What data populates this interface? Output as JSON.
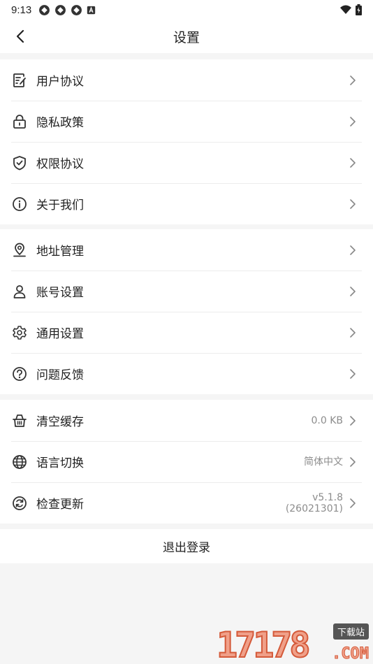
{
  "status_bar": {
    "time": "9:13"
  },
  "header": {
    "title": "设置"
  },
  "groups": [
    {
      "items": [
        {
          "label": "用户协议",
          "icon": "document-edit-icon"
        },
        {
          "label": "隐私政策",
          "icon": "lock-icon"
        },
        {
          "label": "权限协议",
          "icon": "shield-check-icon"
        },
        {
          "label": "关于我们",
          "icon": "info-icon"
        }
      ]
    },
    {
      "items": [
        {
          "label": "地址管理",
          "icon": "location-pin-icon"
        },
        {
          "label": "账号设置",
          "icon": "user-icon"
        },
        {
          "label": "通用设置",
          "icon": "gear-icon"
        },
        {
          "label": "问题反馈",
          "icon": "question-icon"
        }
      ]
    },
    {
      "items": [
        {
          "label": "清空缓存",
          "icon": "basket-icon",
          "value": "0.0 KB"
        },
        {
          "label": "语言切换",
          "icon": "globe-icon",
          "value": "简体中文"
        },
        {
          "label": "检查更新",
          "icon": "refresh-icon",
          "value_line1": "v5.1.8",
          "value_line2": "(26021301)"
        }
      ]
    }
  ],
  "logout": {
    "label": "退出登录"
  },
  "watermark": {
    "number": "17178",
    "badge": "下载站",
    "suffix": ".COM"
  },
  "colors": {
    "background": "#f5f5f5",
    "card": "#ffffff",
    "text": "#222222",
    "secondary_text": "#8c8c8c",
    "divider": "#ececec"
  }
}
